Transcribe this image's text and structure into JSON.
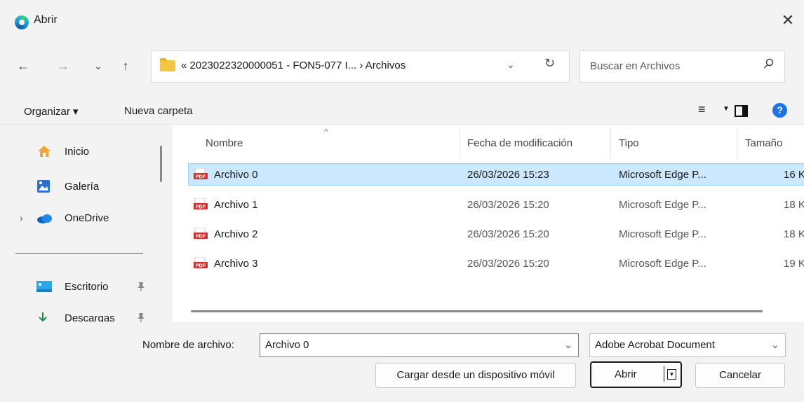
{
  "window": {
    "title": "Abrir",
    "close_label": "✕"
  },
  "nav": {
    "back": "←",
    "forward": "→",
    "recent": "⌄",
    "up": "↑"
  },
  "address": {
    "path": "« 2023022320000051 - FON5-077 I... › Archivos",
    "dropdown": "⌄",
    "refresh": "↻"
  },
  "search": {
    "placeholder": "Buscar en Archivos",
    "icon": "⚲"
  },
  "toolbar": {
    "organize": "Organizar ▾",
    "new_folder": "Nueva carpeta",
    "view_icon": "≡",
    "view_dd": "▼",
    "help": "?"
  },
  "sidebar": {
    "items": [
      {
        "label": "Inicio",
        "icon": "home-icon"
      },
      {
        "label": "Galería",
        "icon": "gallery-icon"
      },
      {
        "label": "OneDrive",
        "icon": "cloud-icon",
        "expander": "›"
      },
      {
        "label": "Escritorio",
        "icon": "desktop-icon",
        "pin": "📌"
      },
      {
        "label": "Descargas",
        "icon": "download-icon",
        "pin": "📌"
      }
    ]
  },
  "columns": {
    "name": "Nombre",
    "date": "Fecha de modificación",
    "type": "Tipo",
    "size": "Tamaño",
    "sort_caret": "^"
  },
  "files": [
    {
      "name": "Archivo 0",
      "date": "26/03/2026 15:23",
      "type": "Microsoft Edge P...",
      "size": "16 K",
      "selected": true
    },
    {
      "name": "Archivo 1",
      "date": "26/03/2026 15:20",
      "type": "Microsoft Edge P...",
      "size": "18 K",
      "selected": false
    },
    {
      "name": "Archivo 2",
      "date": "26/03/2026 15:20",
      "type": "Microsoft Edge P...",
      "size": "18 K",
      "selected": false
    },
    {
      "name": "Archivo 3",
      "date": "26/03/2026 15:20",
      "type": "Microsoft Edge P...",
      "size": "19 K",
      "selected": false
    }
  ],
  "bottom": {
    "filename_label": "Nombre de archivo:",
    "filename_value": "Archivo 0",
    "filetype_value": "Adobe Acrobat Document",
    "dropdown": "⌄",
    "mobile_button": "Cargar desde un dispositivo móvil",
    "open_button": "Abrir",
    "open_split": "▼",
    "cancel_button": "Cancelar",
    "grip": "⋰"
  },
  "colors": {
    "selection": "#cce8ff",
    "selection_border": "#99d1ff",
    "folder": "#f4c542",
    "help": "#1a73e8",
    "pdf": "#d0312d"
  }
}
